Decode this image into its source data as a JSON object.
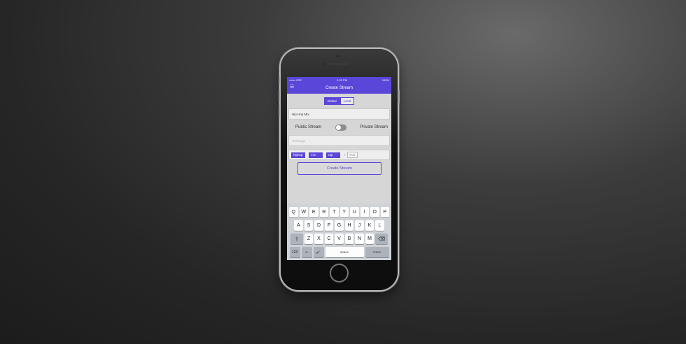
{
  "status_bar": {
    "carrier": "•••oo CSC",
    "time": "1:20 PM",
    "battery": "100%"
  },
  "nav": {
    "title": "Create Stream",
    "menu_icon": "menu-icon"
  },
  "segment": {
    "options": [
      "Global",
      "Local"
    ],
    "selected": "Global"
  },
  "stream_name": {
    "value": "Hip Hop Mix"
  },
  "privacy": {
    "left_label": "Public Stream",
    "right_label": "Private Stream",
    "is_private": false
  },
  "description": {
    "placeholder": "Hashtags"
  },
  "tags": [
    "hiphop",
    "mix",
    "rap"
  ],
  "add_tag": {
    "plus": "+",
    "label": "TAG"
  },
  "create_button": {
    "label": "Create Stream"
  },
  "keyboard": {
    "row1": [
      "Q",
      "W",
      "E",
      "R",
      "T",
      "Y",
      "U",
      "I",
      "O",
      "P"
    ],
    "row2": [
      "A",
      "S",
      "D",
      "F",
      "G",
      "H",
      "J",
      "K",
      "L"
    ],
    "row3": [
      "Z",
      "X",
      "C",
      "V",
      "B",
      "N",
      "M"
    ],
    "shift": "⇧",
    "backspace": "⌫",
    "numbers": "123",
    "emoji": "☺",
    "mic": "🎤",
    "space": "space",
    "return": "return"
  },
  "colors": {
    "accent": "#5a46d8",
    "background": "#2a2a2a"
  }
}
